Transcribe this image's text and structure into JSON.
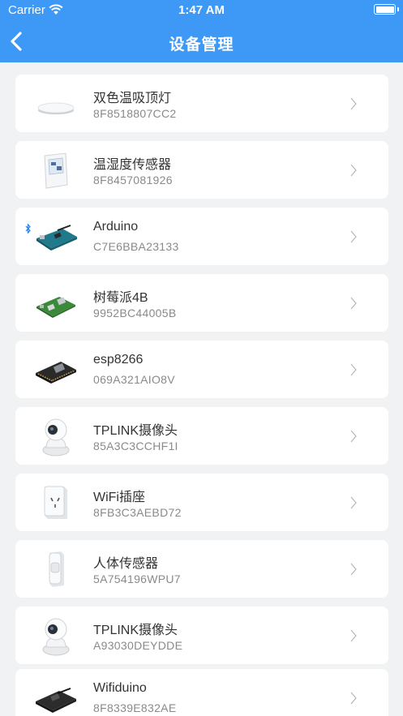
{
  "status": {
    "carrier": "Carrier",
    "time": "1:47 AM"
  },
  "header": {
    "title": "设备管理"
  },
  "devices": [
    {
      "name": "双色温吸顶灯",
      "code": "8F8518807CC2",
      "icon": "ceiling-light"
    },
    {
      "name": "温湿度传感器",
      "code": "8F8457081926",
      "icon": "temperature-sensor"
    },
    {
      "name": "Arduino",
      "code": "C7E6BBA23133",
      "icon": "arduino-board",
      "bluetooth": true
    },
    {
      "name": "树莓派4B",
      "code": "9952BC44005B",
      "icon": "raspberry-pi-board"
    },
    {
      "name": "esp8266",
      "code": "069A321AIO8V",
      "icon": "esp8266-board"
    },
    {
      "name": "TPLINK摄像头",
      "code": "85A3C3CCHF1I",
      "icon": "camera"
    },
    {
      "name": "WiFi插座",
      "code": "8FB3C3AEBD72",
      "icon": "wifi-socket"
    },
    {
      "name": "人体传感器",
      "code": "5A754196WPU7",
      "icon": "motion-sensor"
    },
    {
      "name": "TPLINK摄像头",
      "code": "A93030DEYDDE",
      "icon": "camera"
    },
    {
      "name": "Wifiduino",
      "code": "8F8339E832AE",
      "icon": "wifiduino-board"
    }
  ],
  "colors": {
    "header": "#3d98f6",
    "background": "#f1f2f4"
  }
}
